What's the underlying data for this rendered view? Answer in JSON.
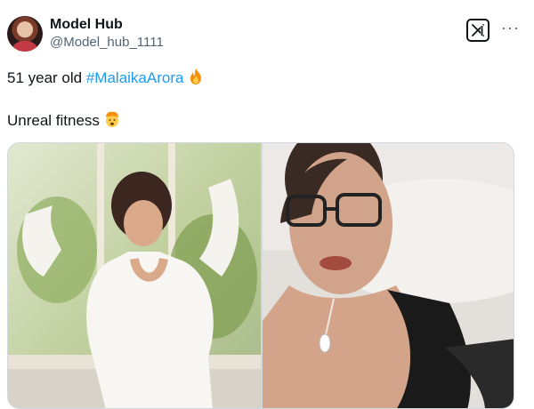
{
  "author": {
    "display_name": "Model Hub",
    "handle": "@Model_hub_1111"
  },
  "tweet": {
    "line1_prefix": "51 year old ",
    "hashtag": "#MalaikaArora",
    "line1_emoji": "fire-emoji",
    "line2_text": "Unreal fitness",
    "line2_emoji": "exploding-head-emoji"
  },
  "header_icons": {
    "brand": "x-logo-icon",
    "menu": "more-options-icon",
    "menu_glyph": "···"
  },
  "media": [
    {
      "name": "photo-left"
    },
    {
      "name": "photo-right"
    }
  ],
  "colors": {
    "hashtag": "#1d9bf0",
    "handle": "#536471",
    "text": "#0f1419"
  }
}
